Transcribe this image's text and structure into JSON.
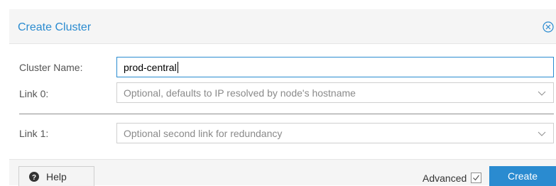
{
  "dialog": {
    "title": "Create Cluster",
    "close_icon": "close-circle-icon"
  },
  "form": {
    "cluster_name": {
      "label": "Cluster Name:",
      "value": "prod-central"
    },
    "link0": {
      "label": "Link 0:",
      "placeholder": "Optional, defaults to IP resolved by node's hostname",
      "icon": "chevron-down-icon"
    },
    "link1": {
      "label": "Link 1:",
      "placeholder": "Optional second link for redundancy",
      "icon": "chevron-down-icon"
    }
  },
  "footer": {
    "help_label": "Help",
    "help_icon": "question-circle-icon",
    "advanced_label": "Advanced",
    "advanced_checked": true,
    "create_label": "Create"
  },
  "colors": {
    "accent": "#2a8bd0",
    "header_bg": "#f5f5f5",
    "border": "#cfcfcf",
    "placeholder_text": "#8a8a8a"
  }
}
